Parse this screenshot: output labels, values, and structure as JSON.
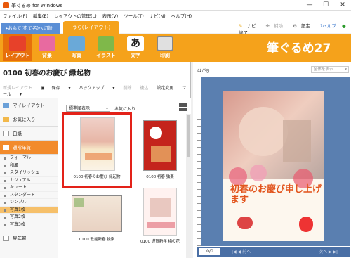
{
  "window": {
    "title": "筆ぐるめ for Windows",
    "min": "—",
    "max": "☐",
    "close": "✕"
  },
  "menu": [
    "ファイル(F)",
    "編集(E)",
    "レイアウトの管理(L)",
    "表示(V)",
    "ツール(T)",
    "ナビ(N)",
    "ヘルプ(H)"
  ],
  "tabs": {
    "front": "▸おもて(宛て名)へ切替",
    "back": "うら(レイアウト)"
  },
  "top_links": {
    "navi": "ナビ",
    "assist": "補助",
    "settings": "設定",
    "help": "?ヘルプ",
    "quit": "終了"
  },
  "toolbar": [
    {
      "label": "レイアウト",
      "icon": "layout-icon",
      "color": "#e7412a"
    },
    {
      "label": "背景",
      "icon": "background-icon",
      "color": "#e86aa0"
    },
    {
      "label": "写真",
      "icon": "photo-icon",
      "color": "#6aa9d8"
    },
    {
      "label": "イラスト",
      "icon": "illustration-icon",
      "color": "#7fb84a"
    },
    {
      "label": "文字",
      "icon": "text-brush-icon",
      "color": "#222222"
    },
    {
      "label": "印刷",
      "icon": "printer-icon",
      "color": "#cfcfcf"
    }
  ],
  "brand": "筆ぐるめ27",
  "panel_title": "0100 初春のお慶び 縁起物",
  "actions": {
    "new_layout": "新規レイアウト",
    "save": "保存",
    "backup": "バックアップ",
    "delete": "削除",
    "copy": "複込",
    "settings_change": "設定変更",
    "tools": "ツール"
  },
  "sidebar": {
    "big": [
      "マイレイアウト",
      "お気に入り",
      "白紙",
      "通常年賀"
    ],
    "small": [
      "フォーマル",
      "和風",
      "スタイリッシュ",
      "カジュアル",
      "キュート",
      "スタンダード",
      "シンプル",
      "写真1枚",
      "写真2枚",
      "写真3枚"
    ],
    "bottom": "昇年賀"
  },
  "sort": "標準順表示",
  "favorite": "お気に入り",
  "cards": [
    {
      "label": "0100 初春のお慶び 縁起物"
    },
    {
      "label": "0100 初春 独楽"
    },
    {
      "label": "0100 歌謡新春 独楽"
    },
    {
      "label": "0100 謹賀新年 梅の花"
    }
  ],
  "preview": {
    "label": "はがき",
    "zoom": "全体を表示",
    "page": "0/0",
    "greeting": "初春のお慶び申し上げます",
    "prev": "前へ",
    "next": "次へ"
  },
  "colors": {
    "orange": "#f5a21b",
    "red_box": "#e32219",
    "blue": "#5a7fb0"
  }
}
